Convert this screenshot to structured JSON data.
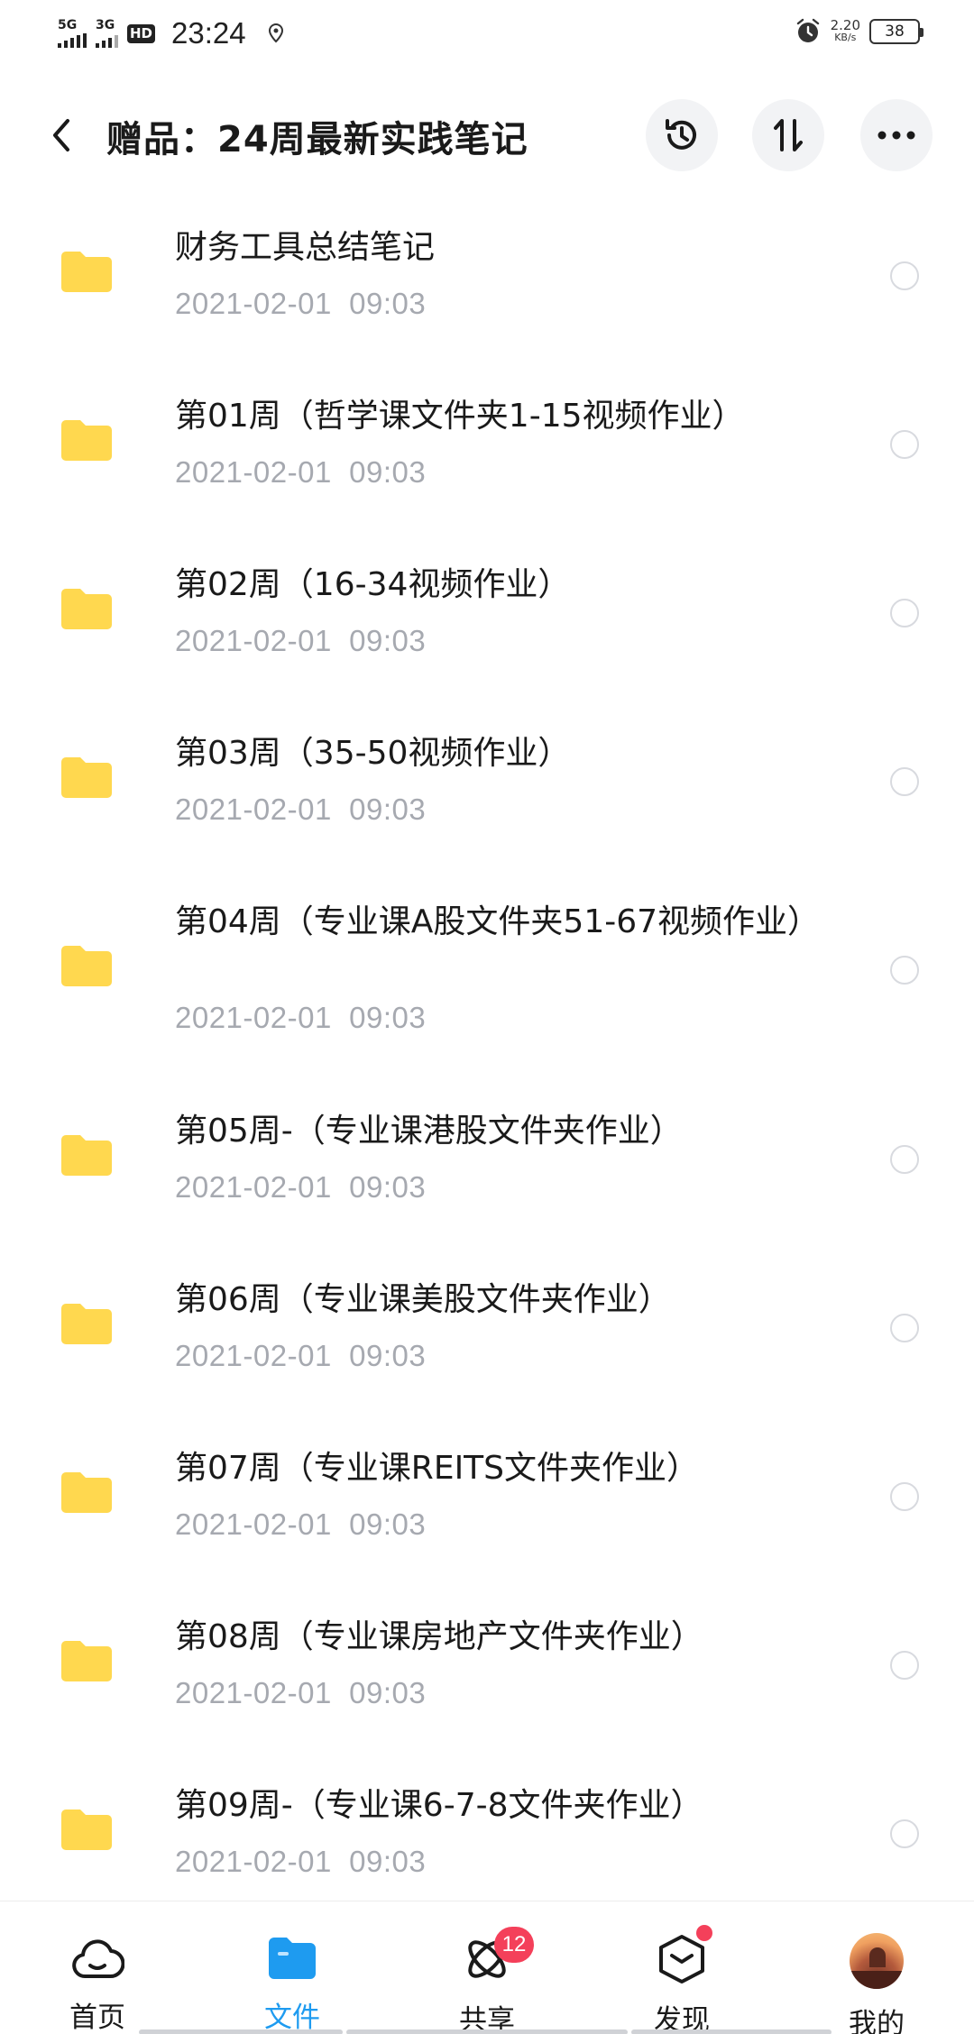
{
  "status_bar": {
    "signal1": "5G",
    "signal2": "3G",
    "hd": "HD",
    "time": "23:24",
    "net_speed": "2.20",
    "net_unit": "KB/s",
    "battery": "38"
  },
  "header": {
    "title": "赠品：24周最新实践笔记"
  },
  "files": [
    {
      "name": "财务工具总结笔记",
      "date": "2021-02-01  09:03"
    },
    {
      "name": "第01周（哲学课文件夹1-15视频作业）",
      "date": "2021-02-01  09:03"
    },
    {
      "name": "第02周（16-34视频作业）",
      "date": "2021-02-01  09:03"
    },
    {
      "name": "第03周（35-50视频作业）",
      "date": "2021-02-01  09:03"
    },
    {
      "name": "第04周（专业课A股文件夹51-67视频作业）",
      "date": "2021-02-01  09:03"
    },
    {
      "name": "第05周-（专业课港股文件夹作业）",
      "date": "2021-02-01  09:03"
    },
    {
      "name": "第06周（专业课美股文件夹作业）",
      "date": "2021-02-01  09:03"
    },
    {
      "name": "第07周（专业课REITS文件夹作业）",
      "date": "2021-02-01  09:03"
    },
    {
      "name": "第08周（专业课房地产文件夹作业）",
      "date": "2021-02-01  09:03"
    },
    {
      "name": "第09周-（专业课6-7-8文件夹作业）",
      "date": "2021-02-01  09:03"
    }
  ],
  "bottom_nav": {
    "home": "首页",
    "files": "文件",
    "share": "共享",
    "share_badge": "12",
    "discover": "发现",
    "mine": "我的"
  },
  "colors": {
    "folder": "#FFD84F",
    "accent": "#1E9BF0",
    "badge": "#F4405A",
    "date_text": "#A6A9B0"
  }
}
